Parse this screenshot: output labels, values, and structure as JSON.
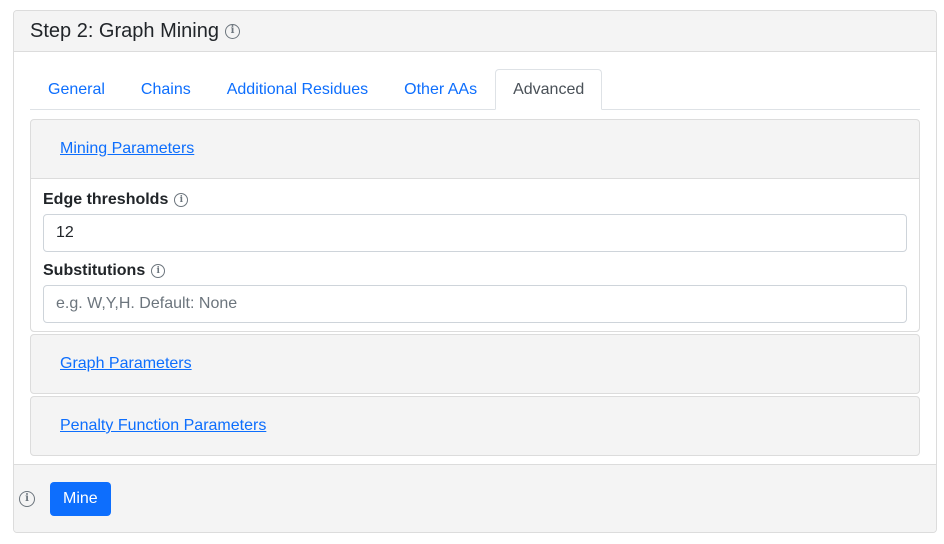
{
  "card": {
    "title": "Step 2: Graph Mining",
    "title_icon": "info-icon"
  },
  "tabs": [
    {
      "label": "General",
      "active": false
    },
    {
      "label": "Chains",
      "active": false
    },
    {
      "label": "Additional Residues",
      "active": false
    },
    {
      "label": "Other AAs",
      "active": false
    },
    {
      "label": "Advanced",
      "active": true
    }
  ],
  "accordion": {
    "mining": {
      "title": "Mining Parameters",
      "expanded": true,
      "fields": {
        "edge_thresholds": {
          "label": "Edge thresholds",
          "value": "12",
          "placeholder": ""
        },
        "substitutions": {
          "label": "Substitutions",
          "value": "",
          "placeholder": "e.g. W,Y,H. Default: None"
        }
      }
    },
    "graph": {
      "title": "Graph Parameters",
      "expanded": false
    },
    "penalty": {
      "title": "Penalty Function Parameters",
      "expanded": false
    }
  },
  "footer": {
    "info_icon": "info-icon",
    "mine_button": "Mine"
  },
  "colors": {
    "accent": "#0d6efd",
    "panel_bg": "#f4f4f4",
    "border": "#dcdcdc"
  }
}
